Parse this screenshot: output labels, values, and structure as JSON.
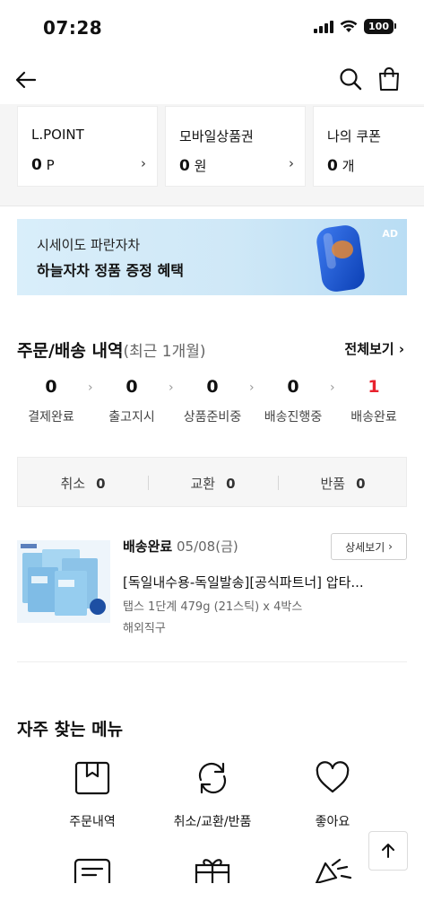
{
  "status_bar": {
    "time": "07:28",
    "battery": "100"
  },
  "nav": {
    "back_icon": "arrow-left-icon",
    "search_icon": "search-icon",
    "cart_icon": "shopping-bag-icon"
  },
  "points": [
    {
      "title": "L.POINT",
      "value": "0",
      "unit": "P"
    },
    {
      "title": "모바일상품권",
      "value": "0",
      "unit": "원"
    },
    {
      "title": "나의 쿠폰",
      "value": "0",
      "unit": "개"
    }
  ],
  "ad": {
    "line1": "시세이도 파란자차",
    "line2": "하늘자차 정품 증정 혜택",
    "badge": "AD"
  },
  "orders": {
    "title": "주문/배송 내역",
    "subtitle": "(최근 1개월)",
    "view_all": "전체보기",
    "steps": [
      {
        "label": "결제완료",
        "count": "0"
      },
      {
        "label": "출고지시",
        "count": "0"
      },
      {
        "label": "상품준비중",
        "count": "0"
      },
      {
        "label": "배송진행중",
        "count": "0"
      },
      {
        "label": "배송완료",
        "count": "1"
      }
    ],
    "cancel_exchange_return": [
      {
        "label": "취소",
        "count": "0"
      },
      {
        "label": "교환",
        "count": "0"
      },
      {
        "label": "반품",
        "count": "0"
      }
    ],
    "accent_color": "#e8222e"
  },
  "order_item": {
    "status": "배송완료",
    "date": "05/08(금)",
    "detail_button": "상세보기",
    "name": "[독일내수용-독일발송][공식파트너] 압타...",
    "option": "탭스 1단계 479g (21스틱) x 4박스",
    "shipping": "해외직구"
  },
  "frequent_menu": {
    "title": "자주 찾는 메뉴",
    "items": [
      {
        "label": "주문내역",
        "icon": "bookmark-box-icon"
      },
      {
        "label": "취소/교환/반품",
        "icon": "refresh-icon"
      },
      {
        "label": "좋아요",
        "icon": "heart-icon"
      }
    ],
    "partial_icons": [
      "message-icon",
      "gift-icon",
      "party-popper-icon"
    ]
  },
  "scroll_top_icon": "arrow-up-icon"
}
